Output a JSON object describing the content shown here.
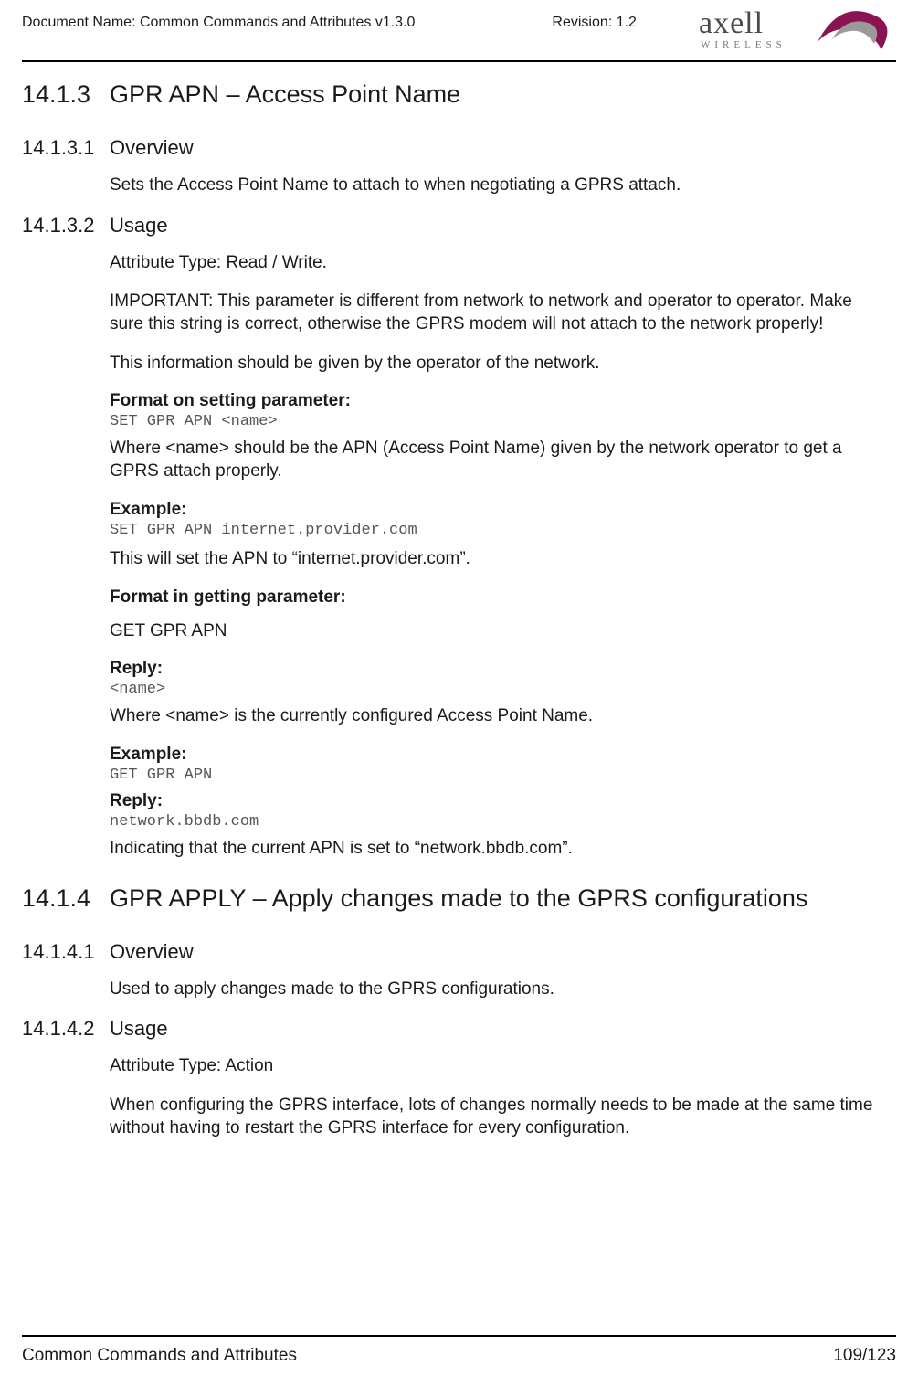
{
  "header": {
    "doc_name": "Document Name: Common Commands and Attributes v1.3.0",
    "revision": "Revision: 1.2",
    "logo_text_main": "axell",
    "logo_text_sub": "WIRELESS"
  },
  "s1": {
    "num": "14.1.3",
    "title": "GPR APN – Access Point Name"
  },
  "s1_1": {
    "num": "14.1.3.1",
    "title": "Overview",
    "p1": "Sets the Access Point Name to attach to when negotiating a GPRS attach."
  },
  "s1_2": {
    "num": "14.1.3.2",
    "title": "Usage",
    "p1": "Attribute Type: Read / Write.",
    "p2": "IMPORTANT: This parameter is different from network to network and operator to operator. Make sure this string is correct, otherwise the GPRS modem will not attach to the network properly!",
    "p3": "This information should be given by the operator of the network.",
    "lbl_format_set": "Format on setting parameter:",
    "code_set": "SET GPR APN <name>",
    "p4": "Where <name> should be the APN (Access Point Name) given by the network operator to get a GPRS attach properly.",
    "lbl_example1": "Example:",
    "code_ex1": "SET GPR APN internet.provider.com",
    "p5": "This will set the APN to “internet.provider.com”.",
    "lbl_format_get": "Format in getting parameter:",
    "p6": "GET GPR APN",
    "lbl_reply1": "Reply:",
    "code_reply1": "<name>",
    "p7": "Where <name> is the currently configured Access Point Name.",
    "lbl_example2": "Example:",
    "code_ex2": "GET GPR APN",
    "lbl_reply2": "Reply:",
    "code_reply2": "network.bbdb.com",
    "p8": "Indicating that the current APN is set to “network.bbdb.com”."
  },
  "s2": {
    "num": "14.1.4",
    "title": "GPR APPLY – Apply changes made to the GPRS configurations"
  },
  "s2_1": {
    "num": "14.1.4.1",
    "title": "Overview",
    "p1": "Used to apply changes made to the GPRS configurations."
  },
  "s2_2": {
    "num": "14.1.4.2",
    "title": "Usage",
    "p1": "Attribute Type: Action",
    "p2": "When configuring the GPRS interface, lots of changes normally needs to be made at the same time without having to restart the GPRS interface for every configuration."
  },
  "footer": {
    "left": "Common Commands and Attributes",
    "right": "109/123"
  }
}
